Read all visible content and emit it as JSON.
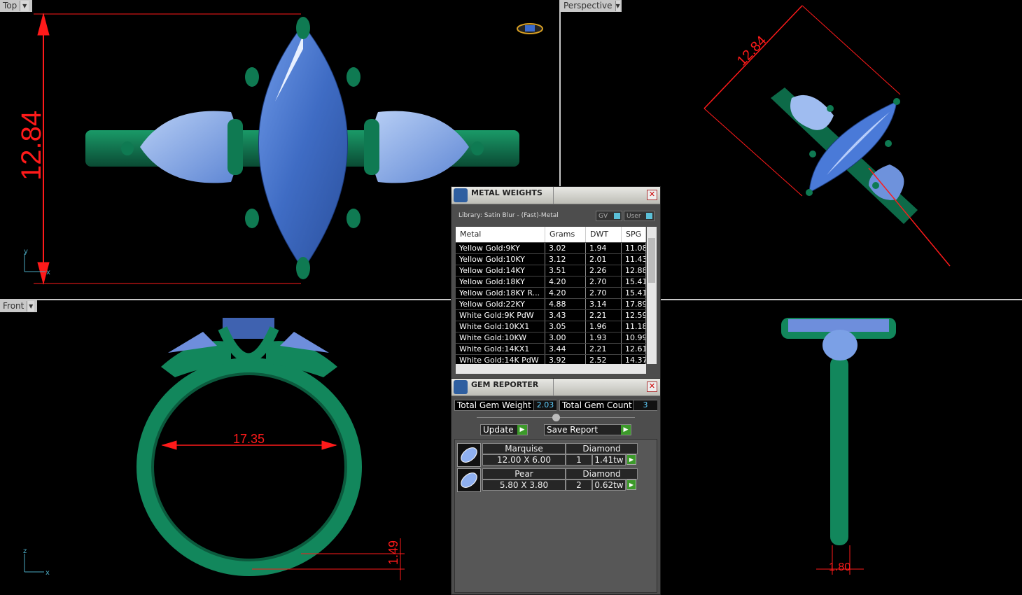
{
  "viewports": {
    "top": {
      "label": "Top",
      "dimension": "12.84"
    },
    "perspective": {
      "label": "Perspective",
      "dimension": "12.84"
    },
    "front": {
      "label": "Front",
      "dimension_inner": "17.35",
      "dimension_thickness": "1.49",
      "axis_z": "z",
      "axis_x": "x"
    },
    "right": {
      "dimension_width": "1.80"
    },
    "top_axis": {
      "y": "y",
      "x": "x"
    }
  },
  "metal_weights": {
    "title": "METAL WEIGHTS",
    "library": "Library: Satin Blur - (Fast)-Metal",
    "toggle_gv": "GV",
    "toggle_user": "User",
    "columns": [
      "Metal",
      "Grams",
      "DWT",
      "SPG"
    ],
    "rows": [
      {
        "metal": "Yellow Gold:9KY",
        "grams": "3.02",
        "dwt": "1.94",
        "spg": "11.08"
      },
      {
        "metal": "Yellow Gold:10KY",
        "grams": "3.12",
        "dwt": "2.01",
        "spg": "11.43"
      },
      {
        "metal": "Yellow Gold:14KY",
        "grams": "3.51",
        "dwt": "2.26",
        "spg": "12.88"
      },
      {
        "metal": "Yellow Gold:18KY",
        "grams": "4.20",
        "dwt": "2.70",
        "spg": "15.41"
      },
      {
        "metal": "Yellow Gold:18KY R...",
        "grams": "4.20",
        "dwt": "2.70",
        "spg": "15.41"
      },
      {
        "metal": "Yellow Gold:22KY",
        "grams": "4.88",
        "dwt": "3.14",
        "spg": "17.89"
      },
      {
        "metal": "White Gold:9K PdW",
        "grams": "3.43",
        "dwt": "2.21",
        "spg": "12.59"
      },
      {
        "metal": "White Gold:10KX1",
        "grams": "3.05",
        "dwt": "1.96",
        "spg": "11.18"
      },
      {
        "metal": "White Gold:10KW",
        "grams": "3.00",
        "dwt": "1.93",
        "spg": "10.99"
      },
      {
        "metal": "White Gold:14KX1",
        "grams": "3.44",
        "dwt": "2.21",
        "spg": "12.61"
      },
      {
        "metal": "White Gold:14K PdW",
        "grams": "3.92",
        "dwt": "2.52",
        "spg": "14.37"
      }
    ]
  },
  "gem_reporter": {
    "title": "GEM REPORTER",
    "total_weight_label": "Total Gem Weight",
    "total_weight_value": "2.03",
    "total_count_label": "Total Gem Count",
    "total_count_value": "3",
    "update_label": "Update",
    "save_label": "Save Report",
    "gems": [
      {
        "cut": "Marquise",
        "stone": "Diamond",
        "size": "12.00 X 6.00",
        "count": "1",
        "weight": "1.41tw"
      },
      {
        "cut": "Pear",
        "stone": "Diamond",
        "size": "5.80 X 3.80",
        "count": "2",
        "weight": "0.62tw"
      }
    ]
  },
  "colors": {
    "metal": "#117a55",
    "gem": "#4f7fd0",
    "dimension": "#ff1a1a"
  }
}
